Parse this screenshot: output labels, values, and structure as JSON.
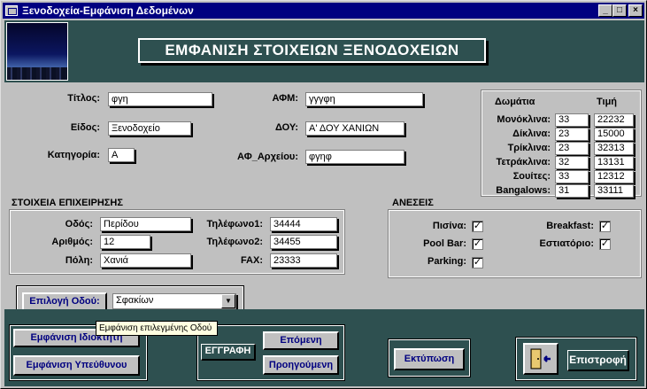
{
  "window": {
    "title": "Ξενοδοχεία-Εμφάνιση Δεδομένων",
    "min_btn": "_",
    "max_btn": "□",
    "close_btn": "×"
  },
  "header": {
    "title": "ΕΜΦΑΝΙΣΗ ΣΤΟΙΧΕΙΩΝ ΞΕΝΟΔΟΧΕΙΩΝ"
  },
  "general": {
    "titlos_label": "Τίτλος:",
    "titlos_value": "φγη",
    "eidos_label": "Είδος:",
    "eidos_value": "Ξενοδοχείο",
    "kategoria_label": "Κατηγορία:",
    "kategoria_value": "Α",
    "afm_label": "ΑΦΜ:",
    "afm_value": "γγγφη",
    "doy_label": "ΔΟΥ:",
    "doy_value": "Α' ΔΟΥ ΧΑΝΙΩΝ",
    "af_archeiou_label": "ΑΦ_Αρχείου:",
    "af_archeiou_value": "φγηφ"
  },
  "rooms": {
    "col_rooms": "Δωμάτια",
    "col_price": "Τιμή",
    "rows": [
      {
        "label": "Μονόκλινα:",
        "count": "33",
        "price": "22232"
      },
      {
        "label": "Δίκλινα:",
        "count": "23",
        "price": "15000"
      },
      {
        "label": "Τρίκλινα:",
        "count": "23",
        "price": "32313"
      },
      {
        "label": "Τετράκλινα:",
        "count": "32",
        "price": "13131"
      },
      {
        "label": "Σουίτες:",
        "count": "33",
        "price": "12312"
      },
      {
        "label": "Bangalows:",
        "count": "31",
        "price": "33111"
      }
    ]
  },
  "business": {
    "section_title": "ΣΤΟΙΧΕΙΑ ΕΠΙΧΕΙΡΗΣΗΣ",
    "odos_label": "Οδός:",
    "odos_value": "Περίδου",
    "arithmos_label": "Αριθμός:",
    "arithmos_value": "12",
    "poli_label": "Πόλη:",
    "poli_value": "Χανιά",
    "tel1_label": "Τηλέφωνο1:",
    "tel1_value": "34444",
    "tel2_label": "Τηλέφωνο2:",
    "tel2_value": "34455",
    "fax_label": "FAX:",
    "fax_value": "23333"
  },
  "amenities": {
    "section_title": "ΑΝΕΣΕΙΣ",
    "pool_label": "Πισίνα:",
    "pool_checked": true,
    "poolbar_label": "Pool Bar:",
    "poolbar_checked": true,
    "parking_label": "Parking:",
    "parking_checked": true,
    "breakfast_label": "Breakfast:",
    "breakfast_checked": true,
    "restaurant_label": "Εστιατόριο:",
    "restaurant_checked": true,
    "check_mark": "✓"
  },
  "street_select": {
    "button_label": "Επιλογή Οδού:",
    "selected": "Σφακίων",
    "tooltip": "Εμφάνιση επιλεγμένης Οδού"
  },
  "footer": {
    "show_owner": "Εμφάνιση Ιδιοκτήτη",
    "show_manager": "Εμφάνιση Υπεύθυνου",
    "record_label": "ΕΓΓΡΑΦΗ",
    "next": "Επόμενη",
    "previous": "Προηγούμενη",
    "print": "Εκτύπωση",
    "return": "Επιστροφή"
  },
  "colors": {
    "teal": "#2e5050",
    "title_bar": "#000080",
    "button_text": "#000080"
  }
}
